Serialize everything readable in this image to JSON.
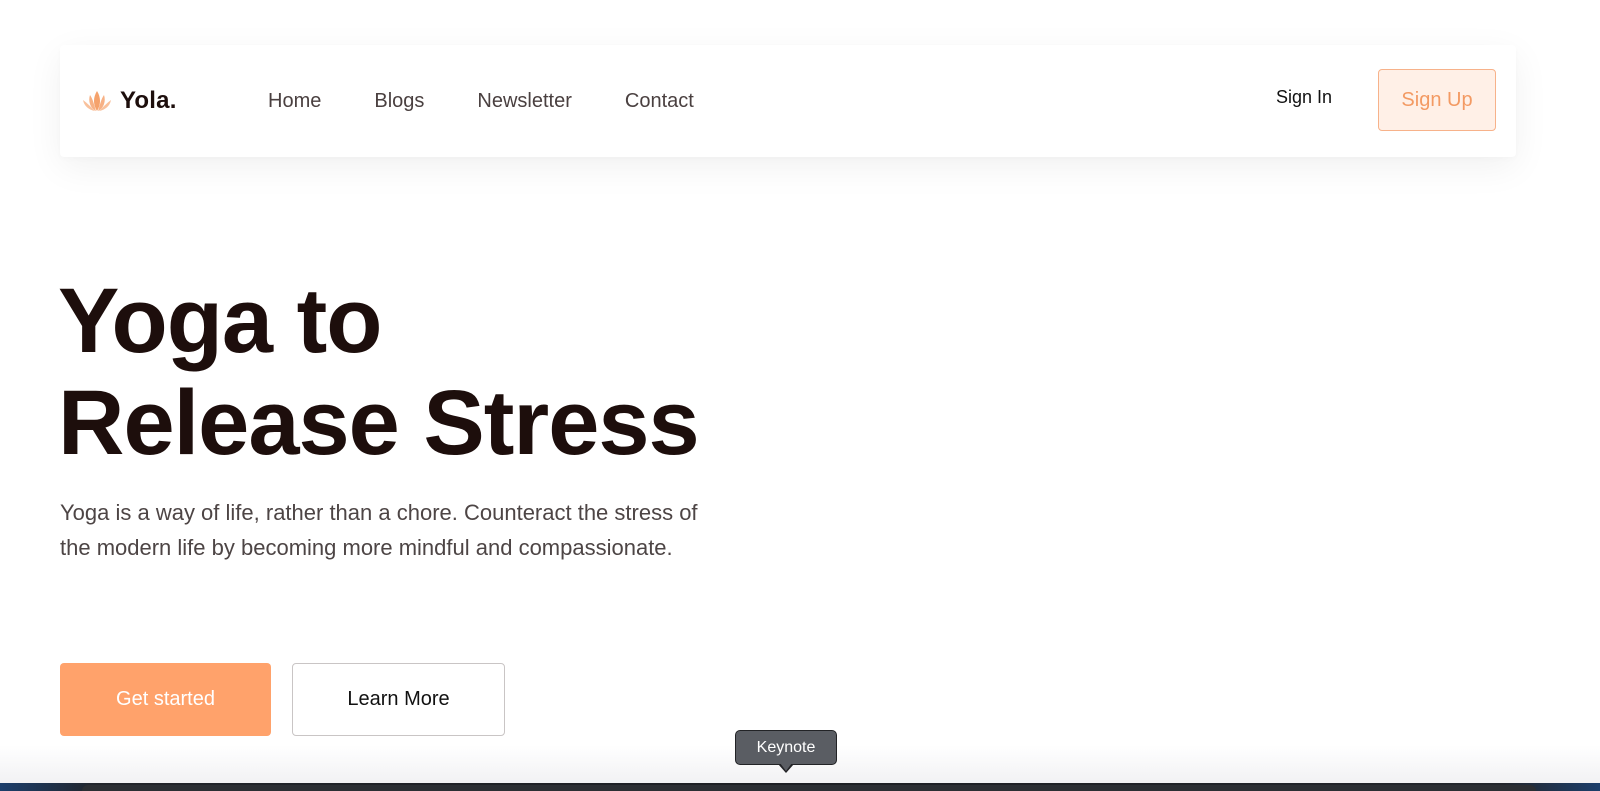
{
  "navbar": {
    "logo_text": "Yola.",
    "logo_icon": "lotus-icon",
    "links": [
      {
        "label": "Home"
      },
      {
        "label": "Blogs"
      },
      {
        "label": "Newsletter"
      },
      {
        "label": "Contact"
      }
    ],
    "signin_label": "Sign In",
    "signup_label": "Sign Up"
  },
  "hero": {
    "title_line1": "Yoga to",
    "title_line2": "Release Stress",
    "description": "Yoga is a way of life, rather than a chore. Counteract the stress of the modern life by becoming more mindful and compassionate.",
    "primary_button": "Get started",
    "secondary_button": "Learn More"
  },
  "dock": {
    "tooltip": "Keynote"
  },
  "colors": {
    "accent": "#ffa26b",
    "signup_border": "#f7b28a",
    "signup_bg": "#fff0e7",
    "signup_text": "#f39a63",
    "heading": "#1d0e0c",
    "body_text": "#4d4545"
  }
}
